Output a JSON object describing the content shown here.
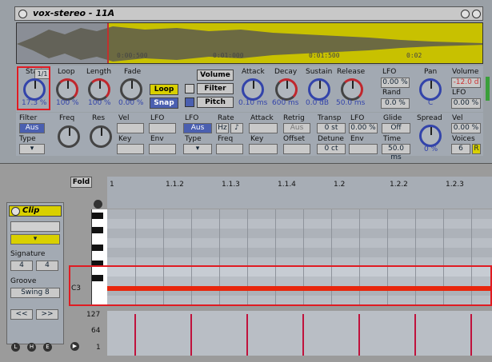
{
  "device": {
    "title": "vox-stereo - 11A",
    "ruler": [
      "0:00:500",
      "0:01:000",
      "0:01:500",
      "0:02"
    ],
    "knobs": [
      {
        "label": "Start",
        "value": "17.3 %",
        "badge": "1/1"
      },
      {
        "label": "Loop",
        "value": "100 %"
      },
      {
        "label": "Length",
        "value": "100 %"
      },
      {
        "label": "Fade",
        "value": "0.00 %"
      },
      {
        "label": "Attack",
        "value": "0.10 ms"
      },
      {
        "label": "Decay",
        "value": "600 ms"
      },
      {
        "label": "Sustain",
        "value": "0.0 dB"
      },
      {
        "label": "Release",
        "value": "50.0 ms"
      },
      {
        "label": "Pan",
        "value": "C"
      },
      {
        "label": "Spread",
        "value": "0 %"
      }
    ],
    "buttons": {
      "loop": "Loop",
      "snap": "Snap",
      "volume": "Volume",
      "filter": "Filter",
      "pitch": "Pitch"
    },
    "lfo_top": {
      "label": "LFO",
      "value": "0.00 %",
      "rand_label": "Rand",
      "rand_value": "0.0 %"
    },
    "volume": {
      "label": "Volume",
      "value": "-12.0 d",
      "lfo_label": "LFO",
      "lfo_value": "0.00 %"
    },
    "row2": {
      "filter": "Filter",
      "filter_type": "Aus",
      "type": "Type",
      "freq": "Freq",
      "res": "Res",
      "vel": "Vel",
      "key": "Key",
      "lfo": "LFO",
      "env": "Env",
      "lfo2": "LFO",
      "lfo2_type": "Aus",
      "type2": "Type",
      "rate": "Rate",
      "hz": "Hz",
      "note": "♪",
      "freq2": "Freq",
      "attack": "Attack",
      "key2": "Key",
      "retrig": "Retrig",
      "retrig_val": "Aus",
      "offset": "Offset",
      "transp": "Transp",
      "transp_val": "0 st",
      "detune": "Detune",
      "detune_val": "0 ct",
      "lfo3": "LFO",
      "lfo3_val": "0.00 %",
      "env2": "Env",
      "glide": "Glide",
      "glide_val": "Off",
      "time": "Time",
      "time_val": "50.0 ms",
      "vel2": "Vel",
      "vel2_val": "0.00 %",
      "voices": "Voices",
      "voices_val": "6",
      "r": "R"
    }
  },
  "clip": {
    "fold": "Fold",
    "title": "Clip",
    "signature_label": "Signature",
    "sig_num": "4",
    "sig_den": "4",
    "groove_label": "Groove",
    "groove_value": "Swing 8",
    "nav_prev": "<<",
    "nav_next": ">>",
    "bottom_buttons": [
      "L",
      "H",
      "E"
    ]
  },
  "editor": {
    "ruler": [
      "1",
      "1.1.2",
      "1.1.3",
      "1.1.4",
      "1.2",
      "1.2.2",
      "1.2.3"
    ],
    "note_label": "C3",
    "vel_labels": [
      "127",
      "64",
      "1"
    ]
  },
  "colors": {
    "accent_yellow": "#d9d000",
    "highlight": "#e01b22",
    "note": "#e8260c",
    "velocity": "#c0123c"
  }
}
